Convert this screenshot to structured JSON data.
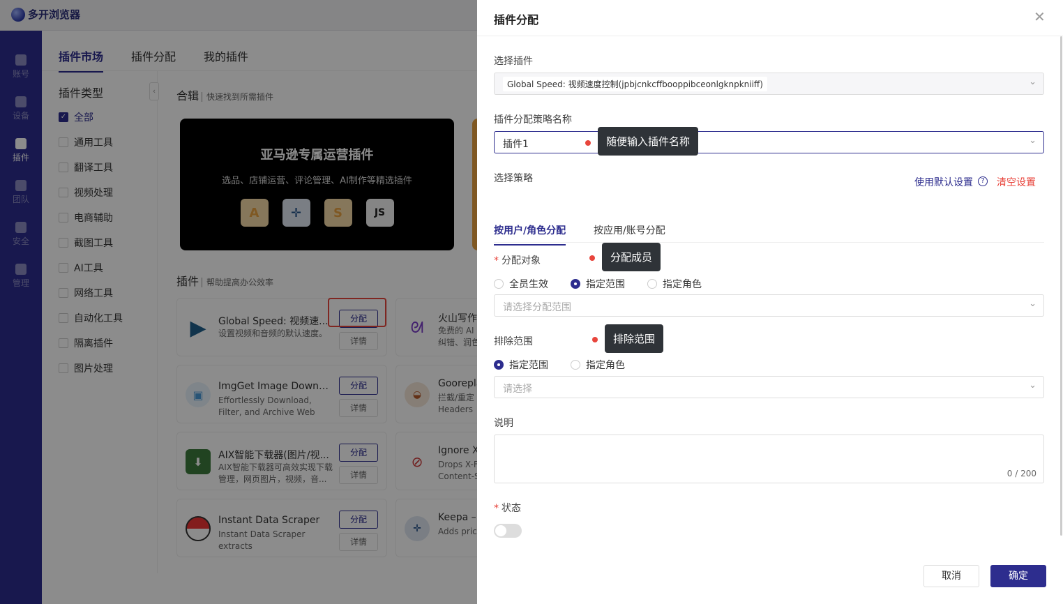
{
  "app": {
    "title": "多开浏览器"
  },
  "sidebar": {
    "items": [
      {
        "label": "账号",
        "icon": "user-icon"
      },
      {
        "label": "设备",
        "icon": "wifi-icon"
      },
      {
        "label": "插件",
        "icon": "plugin-icon"
      },
      {
        "label": "团队",
        "icon": "team-icon"
      },
      {
        "label": "安全",
        "icon": "shield-icon"
      },
      {
        "label": "管理",
        "icon": "gear-icon"
      }
    ]
  },
  "main": {
    "tabs": [
      "插件市场",
      "插件分配",
      "我的插件"
    ],
    "category_title": "插件类型",
    "categories": [
      "全部",
      "通用工具",
      "翻译工具",
      "视频处理",
      "电商辅助",
      "截图工具",
      "AI工具",
      "网络工具",
      "自动化工具",
      "隔离插件",
      "图片处理"
    ],
    "collection": {
      "title": "合辑",
      "sub": "快速找到所需插件"
    },
    "banner": {
      "title": "亚马逊专属运营插件",
      "sub": "选品、店铺运营、评论管理、AI制作等精选插件",
      "icons": [
        "A",
        "✛",
        "S",
        "JS"
      ]
    },
    "plugins_section": {
      "title": "插件",
      "sub": "帮助提高办公效率"
    },
    "cards": [
      {
        "name": "Global Speed: 视频速...",
        "desc": "设置视频和音频的默认速度。",
        "assign": "分配",
        "detail": "详情"
      },
      {
        "name": "ImgGet Image Downlo...",
        "desc": "Effortlessly Download, Filter, and Archive Web Images...",
        "assign": "分配",
        "detail": "详情"
      },
      {
        "name": "AIX智能下载器(图片/视...",
        "desc": "AIX智能下载器可高效实现下载管理，网页图片，视频，音...",
        "assign": "分配",
        "detail": "详情"
      },
      {
        "name": "Instant Data Scraper",
        "desc": "Instant Data Scraper extracts",
        "assign": "分配",
        "detail": "详情"
      }
    ],
    "cards_right": [
      {
        "name": "火山写作",
        "desc1": "免费的 AI",
        "desc2": "纠错、润色"
      },
      {
        "name": "Goorepla",
        "desc1": "拦截/重定",
        "desc2": "Headers"
      },
      {
        "name": "Ignore X-",
        "desc1": "Drops X-F",
        "desc2": "Content-S"
      },
      {
        "name": "Keepa –",
        "desc1": "Adds pric",
        "desc2": ""
      }
    ]
  },
  "drawer": {
    "title": "插件分配",
    "select_plugin_label": "选择插件",
    "select_plugin_value": "Global Speed: 视频速度控制(jpbjcnkcffbooppibceonlgknpkniiff)",
    "strategy_name_label": "插件分配策略名称",
    "strategy_name_value": "插件1",
    "strategy_name_tip": "随便输入插件名称",
    "strategy_label": "选择策略",
    "use_default": "使用默认设置",
    "clear": "清空设置",
    "tabs": [
      "按用户/角色分配",
      "按应用/账号分配"
    ],
    "target_label": "分配对象",
    "target_tip": "分配成员",
    "target_options": [
      "全员生效",
      "指定范围",
      "指定角色"
    ],
    "target_selected": "指定范围",
    "target_placeholder": "请选择分配范围",
    "exclude_label": "排除范围",
    "exclude_tip": "排除范围",
    "exclude_options": [
      "指定范围",
      "指定角色"
    ],
    "exclude_placeholder": "请选择",
    "desc_label": "说明",
    "desc_counter": "0 / 200",
    "status_label": "状态",
    "cancel": "取消",
    "ok": "确定"
  }
}
